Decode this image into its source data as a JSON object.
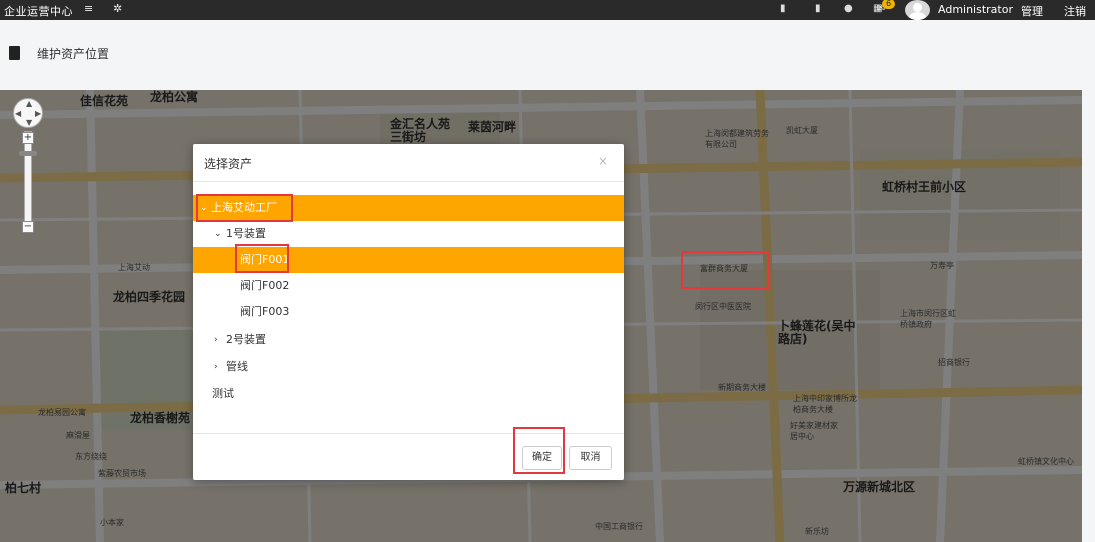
{
  "topbar": {
    "brand": "企业运营中心",
    "menu_icon": "menu-icon",
    "settings_icon": "gear-icon",
    "icons": [
      "map-icon",
      "document-icon",
      "user-icon",
      "calendar-icon",
      "mail-icon"
    ],
    "mail_badge": "6",
    "username": "Administrator",
    "manage_link": "管理",
    "logout_link": "注销"
  },
  "page": {
    "title": "维护资产位置"
  },
  "map": {
    "labels": [
      "佳信花苑",
      "龙柏公寓",
      "金汇名人苑三街坊",
      "莱茵河畔",
      "虹桥村王前小区",
      "龙柏四季花园",
      "龙柏香榭苑",
      "卜蜂莲花(吴中路店)",
      "万源新城北区",
      "柏七村",
      "上海艾动",
      "富群商务大厦",
      "闵行区中医医院",
      "新期商务大楼",
      "招商银行",
      "万寿亭",
      "中国工商银行",
      "东方绕绕",
      "紫藤农贸市场",
      "麻滑屋",
      "小本家",
      "龙柏易园公寓",
      "上海市闵行区虹桥镇政府",
      "好美家建材家居中心",
      "新乐坊",
      "凯虹大厦",
      "上海闵都建筑劳务有限公司",
      "虹桥镇文化中心",
      "上海中印家博所龙柏商务大楼"
    ]
  },
  "modal": {
    "title": "选择资产",
    "close": "×",
    "tree": [
      {
        "label": "上海艾动工厂",
        "level": 0,
        "expanded": true,
        "selected": true
      },
      {
        "label": "1号装置",
        "level": 1,
        "expanded": true,
        "selected": false
      },
      {
        "label": "阀门F001",
        "level": 2,
        "selected": true
      },
      {
        "label": "阀门F002",
        "level": 2,
        "selected": false
      },
      {
        "label": "阀门F003",
        "level": 2,
        "selected": false
      },
      {
        "label": "2号装置",
        "level": 1,
        "expanded": false,
        "selected": false
      },
      {
        "label": "管线",
        "level": 1,
        "expanded": false,
        "selected": false
      },
      {
        "label": "测试",
        "level": 1,
        "selected": false
      }
    ],
    "confirm_label": "确定",
    "cancel_label": "取消"
  },
  "colors": {
    "topbar": "#2a2a2a",
    "selection": "#ffa500",
    "annotation": "#e4393c"
  }
}
